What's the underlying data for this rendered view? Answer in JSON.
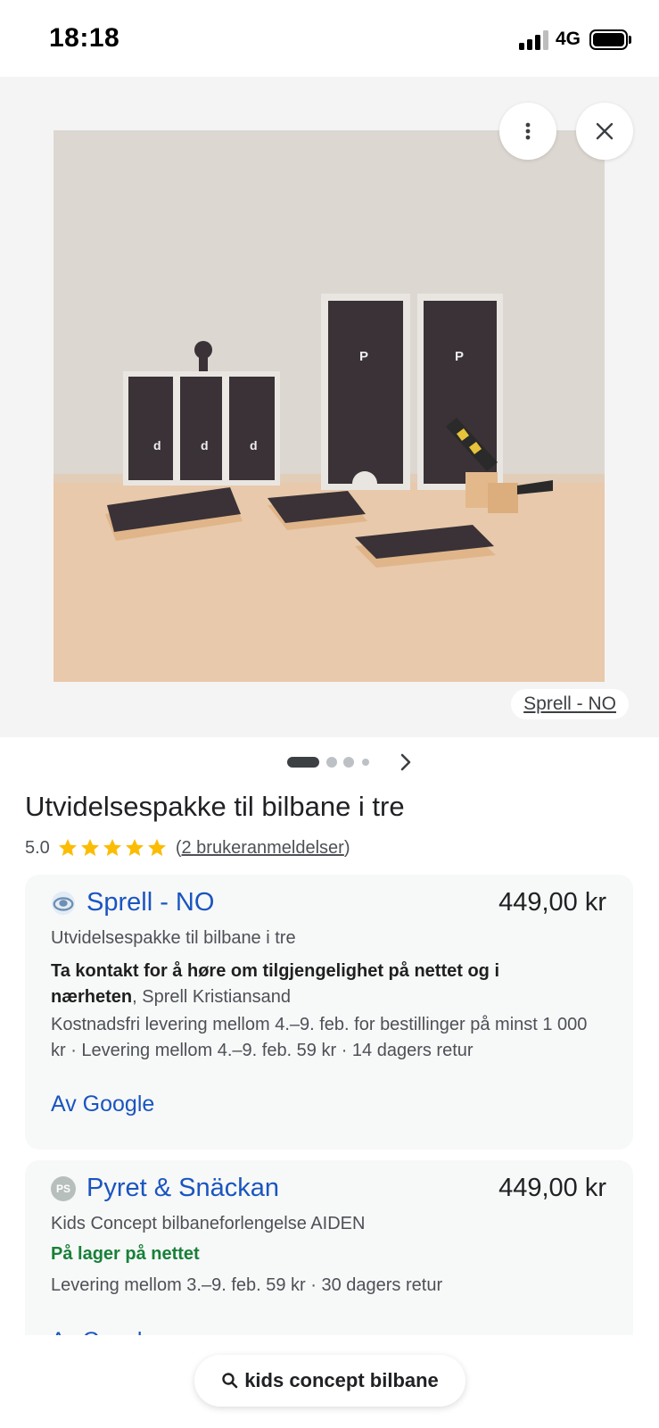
{
  "status_bar": {
    "time": "18:18",
    "network": "4G"
  },
  "image_viewer": {
    "source_label": "Sprell - NO",
    "image_alt": "Product photo",
    "carousel_index": 1,
    "carousel_count": 4
  },
  "product": {
    "title": "Utvidelsespakke til bilbane i tre",
    "rating": "5.0",
    "stars": 5,
    "reviews_open": "(",
    "reviews_link": "2 brukeranmeldelser",
    "reviews_close": ")"
  },
  "offers": [
    {
      "merchant": "Sprell - NO",
      "logo_icon": "sprell-logo-icon",
      "price": "449,00 kr",
      "offer_title": "Utvidelsespakke til bilbane i tre",
      "availability_bold": "Ta kontakt for å høre om tilgjengelighet på nettet og i nærheten",
      "availability_rest": ", Sprell Kristiansand",
      "delivery": "Kostnadsfri levering mellom 4.–9. feb. for bestillinger på minst 1 000 kr · Levering mellom 4.–9. feb. 59 kr · 14 dagers retur",
      "by_google": "Av Google"
    },
    {
      "merchant": "Pyret & Snäckan",
      "logo_text": "PS",
      "price": "449,00 kr",
      "offer_title": "Kids Concept bilbaneforlengelse AIDEN",
      "availability": "På lager på nettet",
      "delivery": "Levering mellom 3.–9. feb. 59 kr · 30 dagers retur",
      "by_google": "Av Google"
    }
  ],
  "search": {
    "query": "kids concept bilbane"
  },
  "colors": {
    "link_blue": "#1a55c0",
    "in_stock_green": "#188038",
    "star_gold": "#fbbc04"
  }
}
